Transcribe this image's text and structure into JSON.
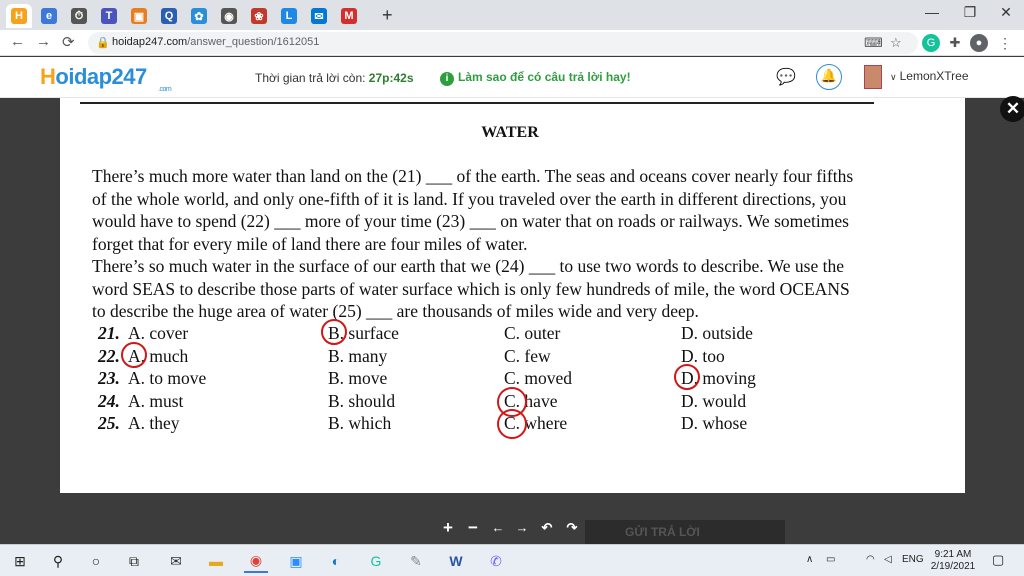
{
  "browser": {
    "tabs": [
      {
        "icon": "H",
        "color": "#f7a21b",
        "active": true
      },
      {
        "icon": "e",
        "color": "#3b78d8",
        "active": false
      },
      {
        "icon": "⏱",
        "color": "#555555",
        "active": false
      },
      {
        "icon": "T",
        "color": "#4b53bc",
        "active": false
      },
      {
        "icon": "▣",
        "color": "#e67e22",
        "active": false
      },
      {
        "icon": "Q",
        "color": "#2b5fb5",
        "active": false
      },
      {
        "icon": "✿",
        "color": "#2b8ed8",
        "active": false
      },
      {
        "icon": "◉",
        "color": "#555555",
        "active": false
      },
      {
        "icon": "❀",
        "color": "#c0392b",
        "active": false
      },
      {
        "icon": "L",
        "color": "#1e88e5",
        "active": false
      },
      {
        "icon": "✉",
        "color": "#0078d4",
        "active": false
      },
      {
        "icon": "M",
        "color": "#d32f2f",
        "active": false
      }
    ],
    "new_tab": "+",
    "minimize": "—",
    "restore": "❐",
    "close": "✕",
    "back": "←",
    "forward": "→",
    "reload": "⟳",
    "url_host": "hoidap247.com",
    "url_path": "/answer_question/1612051"
  },
  "site": {
    "logo_h": "H",
    "logo_rest": "oidap247",
    "logo_suffix": ".com",
    "timer_label": "Thời gian trả lời còn: ",
    "timer_value": "27p:42s",
    "tip_icon": "i",
    "tip": "Làm sao để có câu trả lời hay!",
    "username": "LemonXTree",
    "user_caret": "∨"
  },
  "document": {
    "title": "WATER",
    "paragraph1_lines": [
      "There’s much more water than land on the (21) ___ of the earth. The seas and oceans cover nearly four fifths",
      "of the whole world, and only one-fifth of it is land. If you traveled over the earth in different directions, you",
      "would have to spend (22) ___ more of your time (23) ___ on water that on roads or railways. We sometimes",
      "forget that for every mile of land there are four miles of water."
    ],
    "paragraph2_lines": [
      "There’s so much water in the surface of our earth that we (24) ___ to use two words to describe. We use the",
      "word SEAS to describe those parts of water surface which is only few hundreds of mile, the word OCEANS",
      "to describe the huge area of water (25) ___ are thousands of miles wide and very deep."
    ],
    "questions": [
      {
        "num": "21.",
        "a": "A. cover",
        "b": "B. surface",
        "c": "C. outer",
        "d": "D. outside",
        "circled": "b"
      },
      {
        "num": "22.",
        "a": "A. much",
        "b": "B. many",
        "c": "C. few",
        "d": "D. too",
        "circled": "a"
      },
      {
        "num": "23.",
        "a": "A. to move",
        "b": "B. move",
        "c": "C. moved",
        "d": "D. moving",
        "circled": "d"
      },
      {
        "num": "24.",
        "a": "A. must",
        "b": "B. should",
        "c": "C. have",
        "d": "D. would",
        "circled": "c"
      },
      {
        "num": "25.",
        "a": "A. they",
        "b": "B. which",
        "c": "C. where",
        "d": "D. whose",
        "circled": "c"
      }
    ]
  },
  "viewer": {
    "close": "✕",
    "zoom_in": "+",
    "zoom_out": "−",
    "prev": "←",
    "next": "→",
    "rotate_left": "↶",
    "rotate_right": "↷",
    "submit": "GỬI TRẢ LỜI"
  },
  "taskbar": {
    "lang": "ENG",
    "time": "9:21 AM",
    "date": "2/19/2021"
  }
}
